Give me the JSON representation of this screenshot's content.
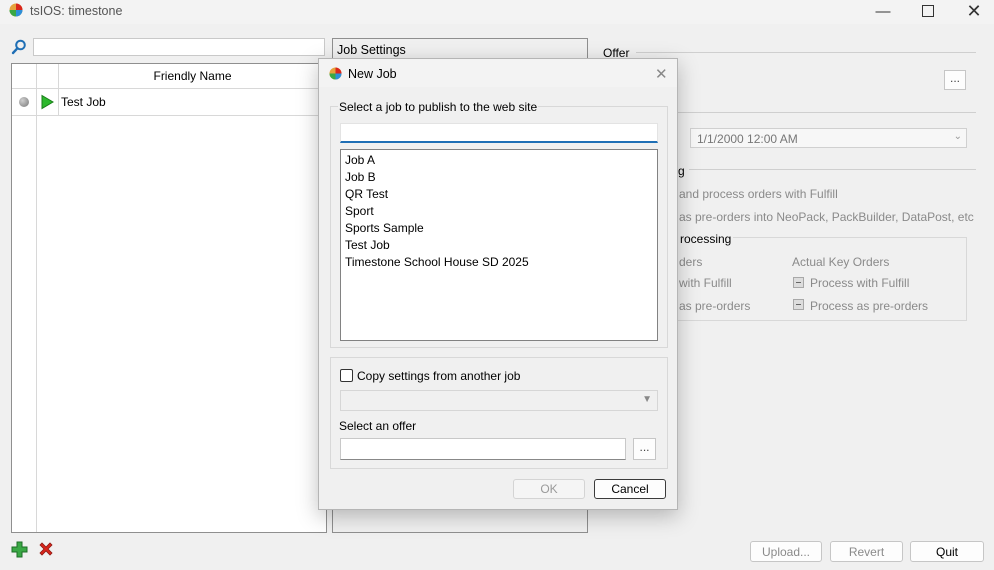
{
  "window": {
    "title": "tsIOS: timestone",
    "minimize_icon": "minimize-icon",
    "maximize_icon": "maximize-icon",
    "close_icon": "close-icon"
  },
  "left_panel": {
    "search_placeholder": "",
    "table": {
      "header": "Friendly Name",
      "rows": [
        {
          "name": "Test Job",
          "status": "inactive",
          "state_icon": "play-icon"
        }
      ]
    }
  },
  "job_settings": {
    "title": "Job Settings"
  },
  "right_panel": {
    "offer_label": "Offer",
    "browse_label": "...",
    "date_value": "1/1/2000 12:00 AM",
    "processing_text_1": "g",
    "option_fulfill_text": "and process orders with Fulfill",
    "option_preorders_text": "as pre-orders into NeoPack, PackBuilder, DataPost, etc",
    "processing_group_label": "rocessing",
    "col_left_header": "ders",
    "col_left_item_1": "with Fulfill",
    "col_left_item_2": "as pre-orders",
    "col_right_header": "Actual Key Orders",
    "col_right_item_1": "Process with Fulfill",
    "col_right_item_2": "Process as pre-orders"
  },
  "bottom_bar": {
    "upload_label": "Upload...",
    "revert_label": "Revert",
    "quit_label": "Quit"
  },
  "dialog": {
    "title": "New Job",
    "publish_label": "Select a job to publish to the web site",
    "filter_value": "",
    "jobs": [
      "Job A",
      "Job B",
      "QR Test",
      "Sport",
      "Sports Sample",
      "Test Job",
      "Timestone School House SD 2025"
    ],
    "copy_label": "Copy settings from another job",
    "copy_checked": false,
    "copy_selected": "",
    "offer_label": "Select an offer",
    "offer_value": "",
    "browse_label": "...",
    "ok_label": "OK",
    "cancel_label": "Cancel"
  },
  "colors": {
    "accent": "#1f6fb5",
    "background": "#f0f0f0",
    "play_green": "#2db82d",
    "remove_red": "#d9261c"
  }
}
